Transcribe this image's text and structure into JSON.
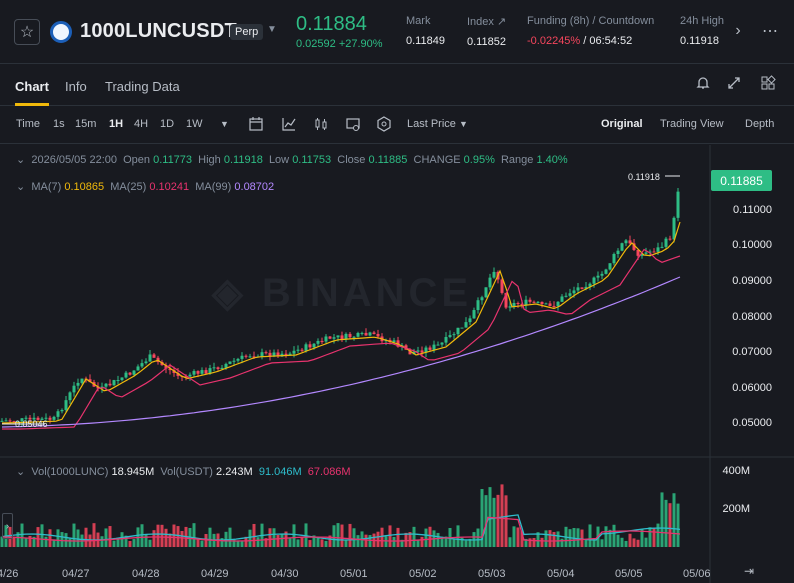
{
  "header": {
    "symbol": "1000LUNCUSDT",
    "badge": "Perp",
    "price": "0.11884",
    "change": "0.02592 +27.90%",
    "mark_label": "Mark",
    "mark": "0.11849",
    "index_label": "Index",
    "index": "0.11852",
    "funding_label": "Funding (8h) / Countdown",
    "funding": "-0.02245%",
    "countdown": " / 06:54:52",
    "h24_label": "24h High",
    "h24": "0.11918"
  },
  "tabs": [
    "Chart",
    "Info",
    "Trading Data"
  ],
  "toolbar": {
    "items": [
      "Time",
      "1s",
      "15m",
      "1H",
      "4H",
      "1D",
      "1W"
    ],
    "active": "1H",
    "price_type": "Last Price",
    "views": [
      "Original",
      "Trading View",
      "Depth"
    ]
  },
  "legend": {
    "date": "2026/05/05 22:00",
    "open_l": "Open",
    "open": "0.11773",
    "high_l": "High",
    "high": "0.11918",
    "low_l": "Low",
    "low": "0.11753",
    "close_l": "Close",
    "close": "0.11885",
    "chg_l": "CHANGE",
    "chg": "0.95%",
    "range_l": "Range",
    "range": "1.40%",
    "ma7_l": "MA(7)",
    "ma7": "0.10865",
    "ma25_l": "MA(25)",
    "ma25": "0.10241",
    "ma99_l": "MA(99)",
    "ma99": "0.08702",
    "vol_l": "Vol(1000LUNC)",
    "vol1": "18.945M",
    "vol2_l": "Vol(USDT)",
    "vol2": "2.243M",
    "v3": "91.046M",
    "v4": "67.086M"
  },
  "colors": {
    "up": "#2ebd85",
    "down": "#f6465d",
    "ma7": "#f0b90b",
    "ma25": "#e8336e",
    "ma99": "#b388ff"
  },
  "chart_data": {
    "type": "candlestick",
    "yticks": [
      "0.11000",
      "0.10000",
      "0.09000",
      "0.08000",
      "0.07000",
      "0.06000",
      "0.05000"
    ],
    "current": "0.11885",
    "high_mark": "0.11918",
    "low_mark": "0.05046",
    "vol_ticks": [
      "400M",
      "200M"
    ],
    "xticks": [
      "4/26",
      "04/27",
      "04/28",
      "04/29",
      "04/30",
      "05/01",
      "05/02",
      "05/03",
      "05/04",
      "05/05",
      "05/06"
    ]
  }
}
